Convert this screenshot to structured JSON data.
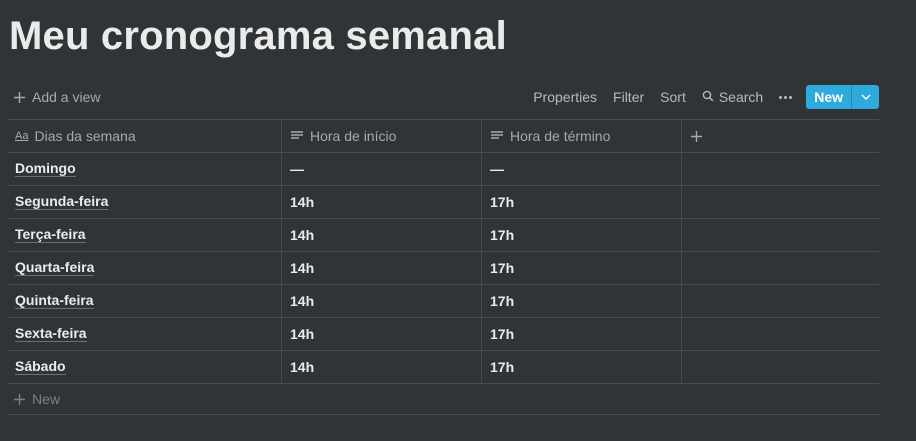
{
  "page": {
    "title": "Meu cronograma semanal"
  },
  "toolbar": {
    "add_view_label": "Add a view",
    "properties_label": "Properties",
    "filter_label": "Filter",
    "sort_label": "Sort",
    "search_label": "Search",
    "new_label": "New",
    "accent_color": "#2eaadc"
  },
  "table": {
    "columns": [
      {
        "label": "Dias da semana",
        "icon": "title-aa-icon"
      },
      {
        "label": "Hora de início",
        "icon": "text-lines-icon"
      },
      {
        "label": "Hora de término",
        "icon": "text-lines-icon"
      }
    ],
    "rows": [
      {
        "day": "Domingo",
        "start": "—",
        "end": "—"
      },
      {
        "day": "Segunda-feira",
        "start": "14h",
        "end": "17h"
      },
      {
        "day": "Terça-feira",
        "start": "14h",
        "end": "17h"
      },
      {
        "day": "Quarta-feira",
        "start": "14h",
        "end": "17h"
      },
      {
        "day": "Quinta-feira",
        "start": "14h",
        "end": "17h"
      },
      {
        "day": "Sexta-feira",
        "start": "14h",
        "end": "17h"
      },
      {
        "day": "Sábado",
        "start": "14h",
        "end": "17h"
      }
    ],
    "add_row_label": "New"
  }
}
